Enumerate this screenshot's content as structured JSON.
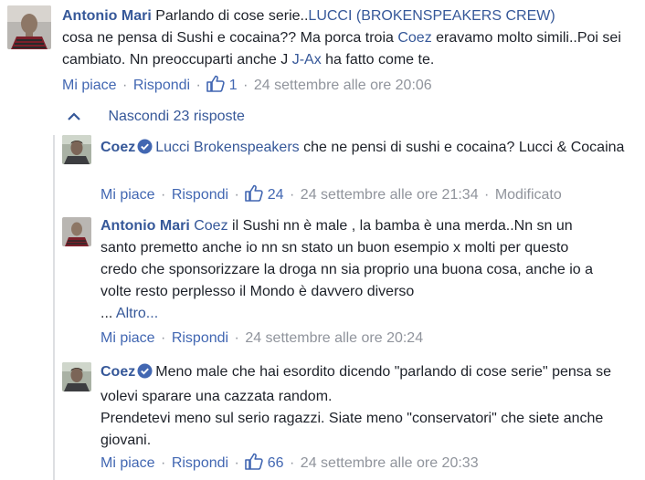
{
  "c1": {
    "author": "Antonio Mari",
    "text1": "Parlando di cose serie..",
    "mention1": "LUCCI (BROKENSPEAKERS CREW)",
    "text2": "cosa ne pensa di Sushi e cocaina?? Ma porca troia ",
    "mention2": "Coez",
    "text3": " eravamo molto simili..Poi sei cambiato. Nn preoccuparti anche J ",
    "mention3": "J-Ax",
    "text4": " ha fatto come te.",
    "like": "Mi piace",
    "reply": "Rispondi",
    "likes": "1",
    "time": "24 settembre alle ore 20:06"
  },
  "hide_replies": "Nascondi 23 risposte",
  "r1": {
    "author": "Coez",
    "mention": "Lucci Brokenspeakers",
    "text": " che ne pensi di sushi e cocaina? Lucci & Cocaina",
    "like": "Mi piace",
    "reply": "Rispondi",
    "likes": "24",
    "time": "24 settembre alle ore 21:34",
    "edited": "Modificato"
  },
  "r2": {
    "author": "Antonio Mari",
    "mention": "Coez",
    "text": " il Sushi nn è male , la bamba è una merda..Nn sn un santo premetto anche io nn sn stato un buon esempio x molti per questo credo che sponsorizzare la droga nn sia proprio una buona cosa, anche io a volte resto perplesso il Mondo è davvero diverso",
    "ellipsis": "... ",
    "more": "Altro...",
    "like": "Mi piace",
    "reply": "Rispondi",
    "time": "24 settembre alle ore 20:24"
  },
  "r3": {
    "author": "Coez",
    "text1": "Meno male che hai esordito dicendo \"parlando di cose serie\" pensa se volevi sparare una cazzata random.",
    "text2": "Prendetevi meno sul serio ragazzi. Siate meno \"conservatori\" che siete anche giovani.",
    "like": "Mi piace",
    "reply": "Rispondi",
    "likes": "66",
    "time": "24 settembre alle ore 20:33"
  },
  "colors": {
    "link": "#365899",
    "meta": "#90949c",
    "verified": "#4267b2"
  }
}
